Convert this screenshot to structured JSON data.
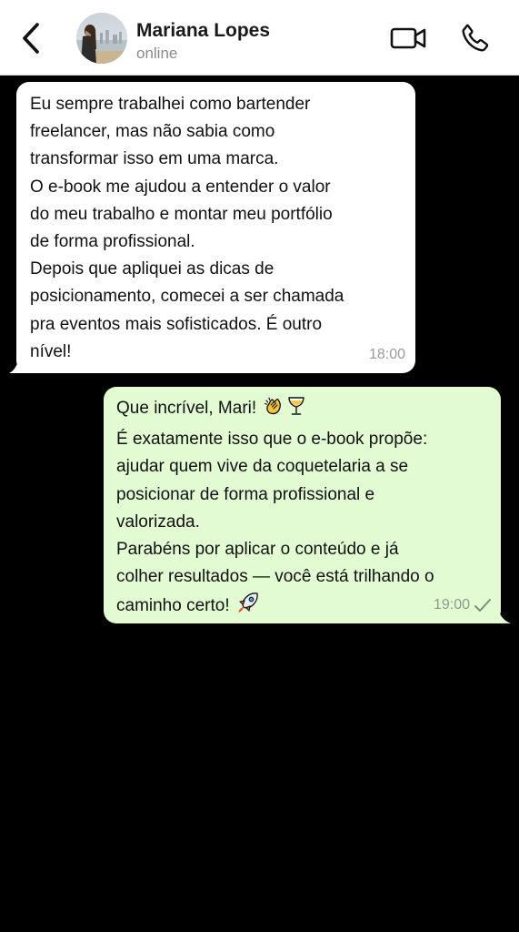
{
  "header": {
    "back_icon": "chevron-left-icon",
    "contact_name": "Mariana Lopes",
    "contact_status": "online",
    "video_icon": "video-camera-icon",
    "call_icon": "phone-icon"
  },
  "messages": [
    {
      "direction": "incoming",
      "lines": [
        "Eu sempre trabalhei como bartender",
        "freelancer, mas não sabia como",
        "transformar isso em uma marca.",
        "O e-book me ajudou a entender o valor",
        "do meu trabalho e montar meu portfólio",
        "de forma profissional.",
        "Depois que apliquei as dicas de",
        "posicionamento, comecei a ser chamada",
        "pra eventos mais sofisticados. É outro",
        "nível!"
      ],
      "time": "18:00"
    },
    {
      "direction": "outgoing",
      "lines": [
        "Que incrível, Mari!",
        "É exatamente isso que o e-book propõe:",
        "ajudar quem vive da coquetelaria a se",
        "posicionar de forma profissional e",
        "valorizada.",
        "Parabéns por aplicar o conteúdo e já",
        "colher resultados — você está trilhando o",
        "caminho certo!"
      ],
      "emojis": [
        "clapping-hands-emoji",
        "cocktail-glass-emoji",
        "rocket-emoji"
      ],
      "time": "19:00",
      "status_icon": "single-check-icon"
    }
  ],
  "colors": {
    "background": "#000000",
    "incoming_bubble": "#ffffff",
    "outgoing_bubble": "#e3fbd2",
    "header": "#ffffff"
  }
}
